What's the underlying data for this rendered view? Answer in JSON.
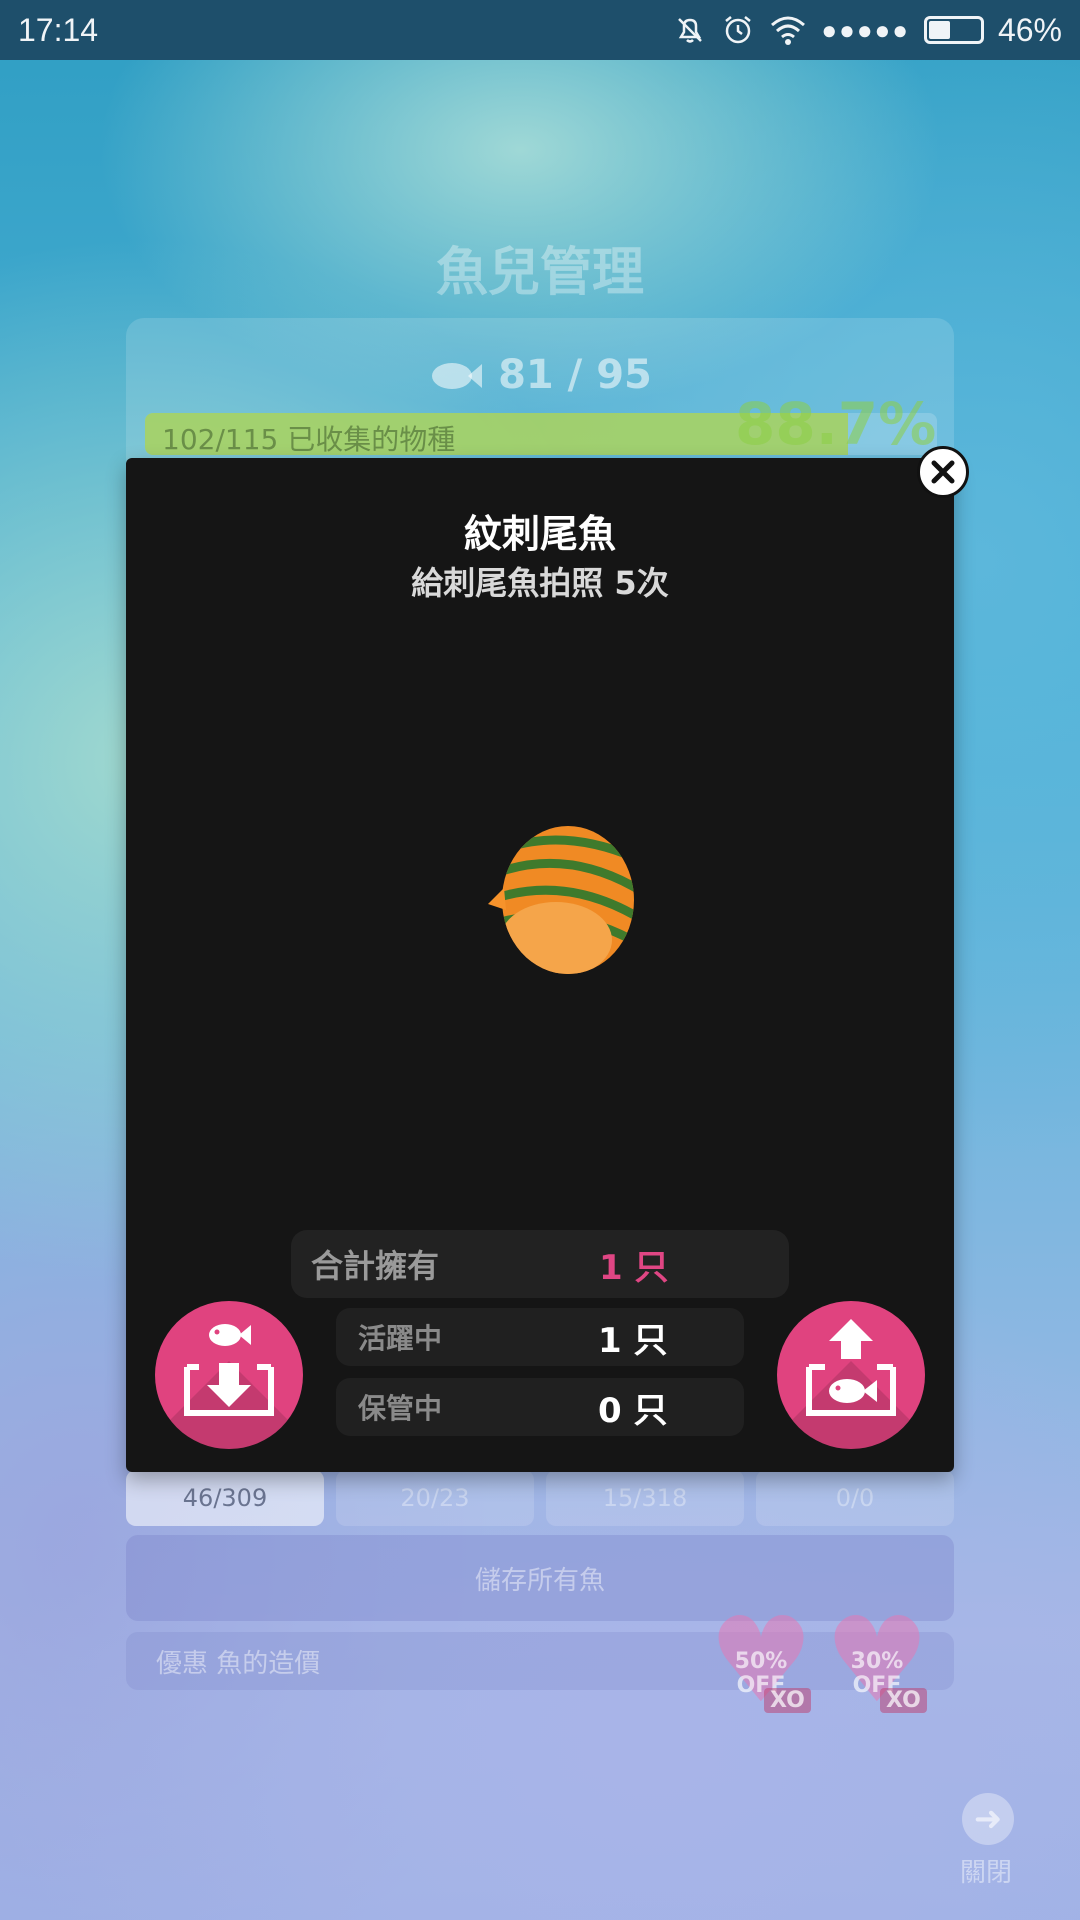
{
  "status_bar": {
    "time": "17:14",
    "battery_percent": "46%",
    "battery_level": 0.46,
    "signal_dots": "●●●●●",
    "icons": [
      "bell-off-icon",
      "alarm-icon",
      "wifi-icon",
      "signal-dots-icon",
      "battery-icon"
    ]
  },
  "background": {
    "title": "魚兒管理",
    "fish_count": "81 / 95",
    "collection_text": "102/115 已收集的物種",
    "collection_percent": "88.7%",
    "collection_fraction": 0.887,
    "tabs": [
      "46/309",
      "20/23",
      "15/318",
      "0/0"
    ],
    "save_all_label": "儲存所有魚",
    "discount_label": "優惠 魚的造價",
    "offers": [
      {
        "percent": "50%",
        "off": "OFF",
        "xo": "XO"
      },
      {
        "percent": "30%",
        "off": "OFF",
        "xo": "XO"
      }
    ],
    "close_label": "關閉"
  },
  "modal": {
    "fish_name": "紋刺尾魚",
    "mission": "給刺尾魚拍照 5次",
    "total_label": "合計擁有",
    "total_value": "1 只",
    "active_label": "活躍中",
    "active_value": "1 只",
    "stored_label": "保管中",
    "stored_value": "0 只",
    "colors": {
      "accent_pink": "#e0437f",
      "modal_bg": "#151515",
      "fish_orange": "#f08a24",
      "fish_stripe": "#3f7a2c"
    },
    "icons": [
      "close-icon",
      "store-fish-icon",
      "release-fish-icon"
    ]
  }
}
